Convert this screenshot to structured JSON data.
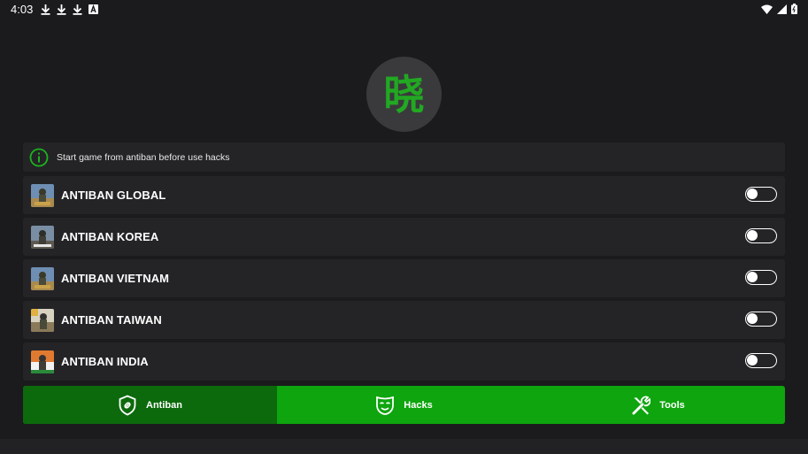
{
  "status_bar": {
    "time": "4:03",
    "left_icons": [
      "download-icon",
      "download-icon",
      "download-icon",
      "font-icon"
    ],
    "right_icons": [
      "wifi-icon",
      "signal-icon",
      "battery-icon"
    ]
  },
  "logo": {
    "glyph": "晓",
    "accent_color": "#22a822"
  },
  "info": {
    "icon": "info-icon",
    "text": "Start game from antiban before use hacks"
  },
  "antiban_list": [
    {
      "label": "ANTIBAN GLOBAL",
      "enabled": false,
      "icon": "pubg-global-icon"
    },
    {
      "label": "ANTIBAN KOREA",
      "enabled": false,
      "icon": "pubg-korea-icon"
    },
    {
      "label": "ANTIBAN VIETNAM",
      "enabled": false,
      "icon": "pubg-vietnam-icon"
    },
    {
      "label": "ANTIBAN TAIWAN",
      "enabled": false,
      "icon": "pubg-taiwan-icon"
    },
    {
      "label": "ANTIBAN INDIA",
      "enabled": false,
      "icon": "pubg-india-icon"
    }
  ],
  "bottom_nav": {
    "selected": "Antiban",
    "items": [
      {
        "label": "Antiban",
        "icon": "shield-link-icon"
      },
      {
        "label": "Hacks",
        "icon": "mask-icon"
      },
      {
        "label": "Tools",
        "icon": "tools-icon"
      }
    ]
  },
  "colors": {
    "background": "#1b1b1d",
    "row_background": "#242427",
    "nav_green": "#0ea50e",
    "nav_active": "#0c6a0c"
  }
}
